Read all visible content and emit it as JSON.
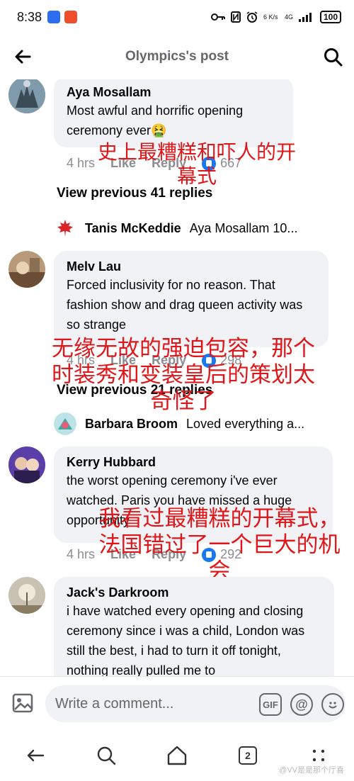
{
  "status": {
    "time": "8:38",
    "network": "4G",
    "speed": "6 K/s",
    "battery": "100"
  },
  "header": {
    "title": "Olympics's post"
  },
  "comments": [
    {
      "name": "Aya Mosallam",
      "text": "Most awful and horrific opening ceremony ever🤮",
      "time": "4 hrs",
      "like": "Like",
      "reply": "Reply",
      "reactions": "667",
      "overlay": "史上最糟糕和吓人的开幕式"
    },
    {
      "name": "Melv Lau",
      "text": "Forced inclusivity for no reason. That fashion show and drag queen activity was so strange",
      "time": "4 hrs",
      "like": "Like",
      "reply": "Reply",
      "reactions": "298",
      "overlay": "无缘无故的强迫包容，那个时装秀和变装皇后的策划太奇怪了"
    },
    {
      "name": "Kerry Hubbard",
      "text": "the worst opening ceremony i've ever watched. Paris you have missed a huge opportunity",
      "time": "4 hrs",
      "like": "Like",
      "reply": "Reply",
      "reactions": "292",
      "overlay": "我看过最糟糕的开幕式，法国错过了一个巨大的机会"
    },
    {
      "name": "Jack's Darkroom",
      "text": "i have watched every opening and closing ceremony since i was a child, London was still the best, i had to turn it off tonight, nothing really pulled me to"
    }
  ],
  "threads": [
    {
      "view_previous": "View previous 41 replies",
      "reply_name": "Tanis McKeddie",
      "reply_snippet": "Aya Mosallam 10..."
    },
    {
      "view_previous": "View previous 21 replies",
      "reply_name": "Barbara Broom",
      "reply_snippet": "Loved everything a..."
    }
  ],
  "composer": {
    "placeholder": "Write a comment...",
    "gif_label": "GIF"
  },
  "nav": {
    "tabs_count": "2"
  },
  "watermark": "@VV是是那个厅喜",
  "colors": {
    "overlay_red": "#e0171a",
    "bubble_bg": "#f0f2f5",
    "meta_gray": "#8a8d91",
    "title_gray": "#65676b"
  }
}
